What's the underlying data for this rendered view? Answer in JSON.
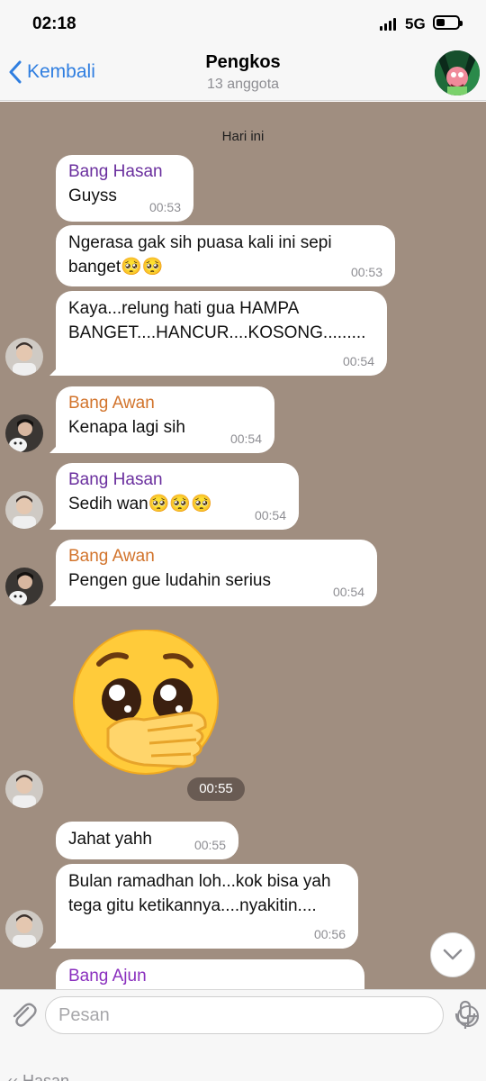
{
  "status_bar": {
    "time": "02:18",
    "network": "5G"
  },
  "header": {
    "back_label": "Kembali",
    "title": "Pengkos",
    "subtitle": "13 anggota"
  },
  "chat": {
    "date_separator": "Hari ini",
    "messages": [
      {
        "sender": "Bang Hasan",
        "text": "Guyss",
        "time": "00:53"
      },
      {
        "sender": "",
        "text": "Ngerasa gak sih puasa kali ini sepi banget🥺🥺",
        "time": "00:53"
      },
      {
        "sender": "",
        "text": "Kaya...relung hati gua HAMPA BANGET....HANCUR....KOSONG.........",
        "time": "00:54"
      },
      {
        "sender": "Bang Awan",
        "text": "Kenapa lagi sih",
        "time": "00:54"
      },
      {
        "sender": "Bang Hasan",
        "text": "Sedih wan🥺🥺🥺",
        "time": "00:54"
      },
      {
        "sender": "Bang Awan",
        "text": "Pengen gue ludahin serius",
        "time": "00:54"
      },
      {
        "sender": "",
        "text": "Jahat yahh",
        "time": "00:55"
      },
      {
        "sender": "",
        "text": "Bulan ramadhan loh...kok bisa yah tega gitu ketikannya....nyakitin....",
        "time": "00:56"
      },
      {
        "sender": "Bang Ajun",
        "text": "",
        "time": ""
      }
    ],
    "sticker": {
      "emoji": "face-holding-back-tears-hand-over-mouth",
      "time": "00:55"
    }
  },
  "input": {
    "placeholder": "Pesan"
  },
  "bottom_peek": "‹‹ Hasan",
  "colors": {
    "chat_bg": "#a08e80",
    "accent": "#2f7ee0",
    "hasan": "#6a2f9e",
    "awan": "#d2742c",
    "ajun": "#8a2fbe"
  }
}
